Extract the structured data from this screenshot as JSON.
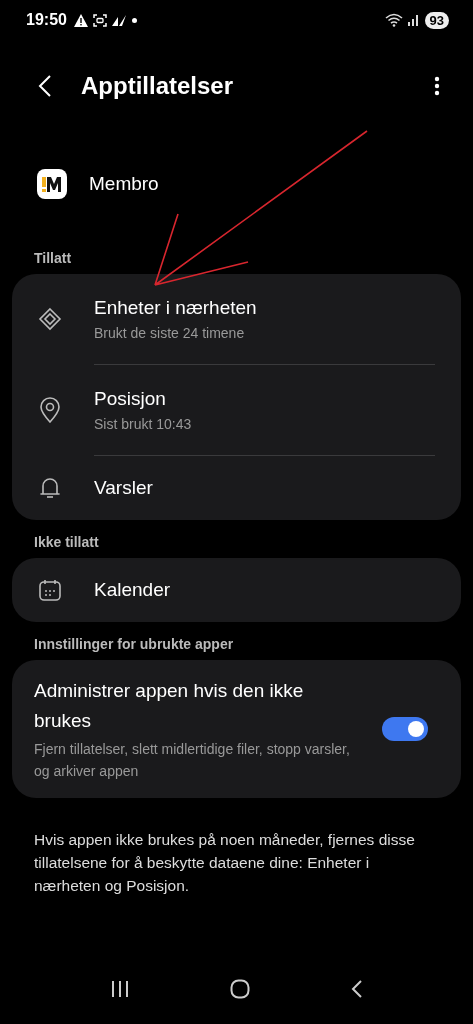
{
  "status_bar": {
    "time": "19:50",
    "battery": "93"
  },
  "header": {
    "title": "Apptillatelser"
  },
  "app": {
    "name": "Membro"
  },
  "sections": [
    {
      "title": "Tillatt",
      "items": [
        {
          "title": "Enheter i nærheten",
          "subtitle": "Brukt de siste 24 timene"
        },
        {
          "title": "Posisjon",
          "subtitle": "Sist brukt 10:43"
        },
        {
          "title": "Varsler"
        }
      ]
    },
    {
      "title": "Ikke tillatt",
      "items": [
        {
          "title": "Kalender"
        }
      ]
    }
  ],
  "unused": {
    "section_title": "Innstillinger for ubrukte apper",
    "title": "Administrer appen hvis den ikke brukes",
    "subtitle": "Fjern tillatelser, slett midlertidige filer, stopp varsler, og arkiver appen",
    "on": true
  },
  "footer_note": "Hvis appen ikke brukes på noen måneder, fjernes disse tillatelsene for å beskytte dataene dine: Enheter i nærheten og Posisjon."
}
